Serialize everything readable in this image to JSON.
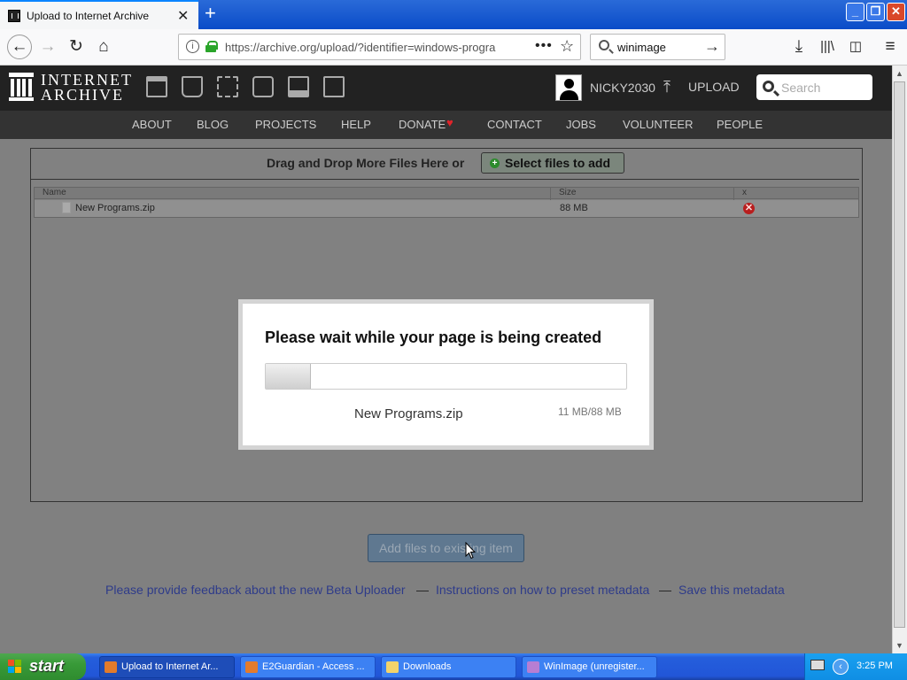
{
  "browser": {
    "tab_title": "Upload to Internet Archive",
    "url": "https://archive.org/upload/?identifier=windows-progra",
    "search_value": "winimage"
  },
  "ia_header": {
    "logo_line1": "INTERNET",
    "logo_line2": "ARCHIVE",
    "username": "NICKY2030",
    "upload_label": "UPLOAD",
    "search_placeholder": "Search"
  },
  "subnav": [
    "ABOUT",
    "BLOG",
    "PROJECTS",
    "HELP",
    "DONATE",
    "CONTACT",
    "JOBS",
    "VOLUNTEER",
    "PEOPLE"
  ],
  "uploader": {
    "drag_text": "Drag and Drop More Files Here or",
    "select_label": "Select files to add",
    "columns": [
      "Name",
      "Size",
      "x"
    ],
    "files": [
      {
        "name": "New Programs.zip",
        "size": "88 MB"
      }
    ]
  },
  "modal": {
    "title": "Please wait while your page is being created",
    "filename": "New Programs.zip",
    "progress_text": "11 MB/88 MB",
    "progress_fraction": 0.125
  },
  "add_button_label": "Add files to existing item",
  "footer_links": {
    "feedback": "Please provide feedback about the new Beta Uploader",
    "instructions": "Instructions on how to preset metadata",
    "save": "Save this metadata",
    "separator": "—"
  },
  "taskbar": {
    "start_label": "start",
    "tasks": [
      {
        "label": "Upload to Internet Ar...",
        "active": true
      },
      {
        "label": "E2Guardian - Access ...",
        "active": false
      },
      {
        "label": "Downloads",
        "active": false
      },
      {
        "label": "WinImage (unregister...",
        "active": false
      }
    ],
    "clock": "3:25 PM"
  },
  "colors": {
    "donate_heart": "#e0242a",
    "modal_bg": "#ffffff",
    "taskbar_blue": "#245edc"
  }
}
